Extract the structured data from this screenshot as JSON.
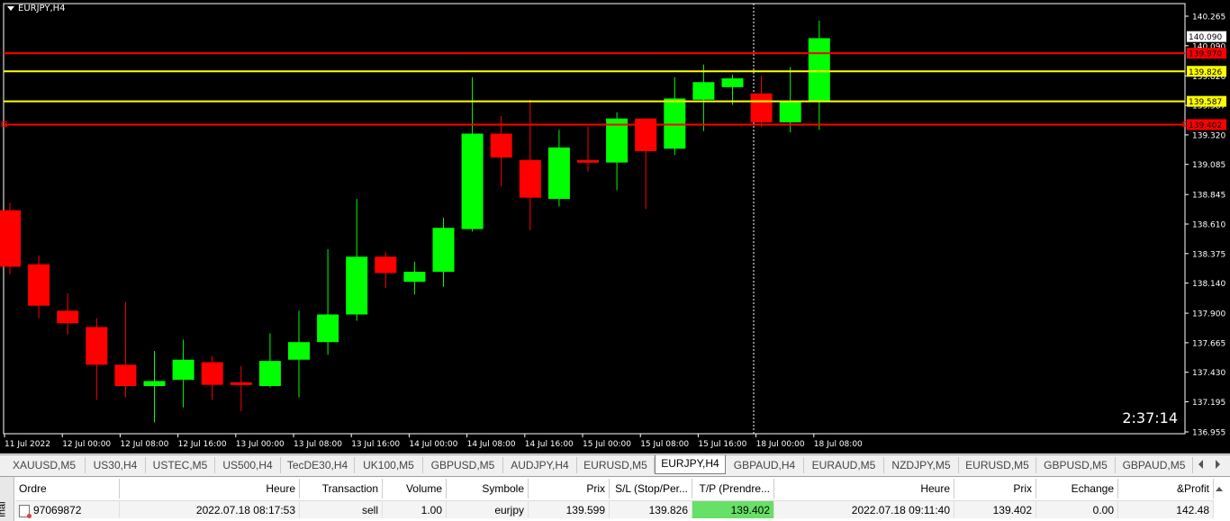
{
  "chart": {
    "symbol_title": "EURJPY,H4",
    "countdown": "2:37:14",
    "price_min": 136.955,
    "price_max": 140.265,
    "price_scale": [
      "140.265",
      "140.090",
      "139.826",
      "139.587",
      "139.320",
      "139.085",
      "138.845",
      "138.610",
      "138.375",
      "138.140",
      "137.900",
      "137.665",
      "137.430",
      "137.195",
      "136.955"
    ],
    "price_ticks": [
      140.265,
      140.03,
      139.79,
      139.555,
      139.32,
      139.085,
      138.845,
      138.61,
      138.375,
      138.14,
      137.9,
      137.665,
      137.43,
      137.195,
      136.955
    ],
    "time_labels": [
      "11 Jul 2022",
      "12 Jul 00:00",
      "12 Jul 08:00",
      "12 Jul 16:00",
      "13 Jul 00:00",
      "13 Jul 08:00",
      "13 Jul 16:00",
      "14 Jul 00:00",
      "14 Jul 08:00",
      "14 Jul 16:00",
      "15 Jul 00:00",
      "15 Jul 08:00",
      "15 Jul 16:00",
      "18 Jul 00:00",
      "18 Jul 08:00"
    ],
    "levels": [
      {
        "price": 139.97,
        "label": "139.970",
        "color": "#ff0000"
      },
      {
        "price": 139.826,
        "label": "139.826",
        "color": "#ffff00"
      },
      {
        "price": 139.587,
        "label": "139.587",
        "color": "#ffff00"
      },
      {
        "price": 139.402,
        "label": "139.402",
        "color": "#ff0000"
      }
    ],
    "bid_label": "140.090",
    "bull_color": "#00ff00",
    "bear_color": "#ff0000",
    "candles": [
      {
        "o": 138.72,
        "h": 138.78,
        "l": 138.21,
        "c": 138.27
      },
      {
        "o": 138.29,
        "h": 138.36,
        "l": 137.86,
        "c": 137.96
      },
      {
        "o": 137.92,
        "h": 138.06,
        "l": 137.73,
        "c": 137.82
      },
      {
        "o": 137.79,
        "h": 137.86,
        "l": 137.21,
        "c": 137.49
      },
      {
        "o": 137.49,
        "h": 137.99,
        "l": 137.23,
        "c": 137.32
      },
      {
        "o": 137.32,
        "h": 137.6,
        "l": 137.03,
        "c": 137.36
      },
      {
        "o": 137.37,
        "h": 137.69,
        "l": 137.15,
        "c": 137.53
      },
      {
        "o": 137.51,
        "h": 137.56,
        "l": 137.21,
        "c": 137.33
      },
      {
        "o": 137.35,
        "h": 137.48,
        "l": 137.12,
        "c": 137.33
      },
      {
        "o": 137.32,
        "h": 137.74,
        "l": 137.31,
        "c": 137.52
      },
      {
        "o": 137.53,
        "h": 137.92,
        "l": 137.23,
        "c": 137.67
      },
      {
        "o": 137.67,
        "h": 138.41,
        "l": 137.57,
        "c": 137.89
      },
      {
        "o": 137.89,
        "h": 138.81,
        "l": 137.84,
        "c": 138.35
      },
      {
        "o": 138.35,
        "h": 138.39,
        "l": 138.1,
        "c": 138.22
      },
      {
        "o": 138.15,
        "h": 138.31,
        "l": 138.05,
        "c": 138.23
      },
      {
        "o": 138.23,
        "h": 138.66,
        "l": 138.11,
        "c": 138.58
      },
      {
        "o": 138.57,
        "h": 139.78,
        "l": 138.55,
        "c": 139.33
      },
      {
        "o": 139.33,
        "h": 139.47,
        "l": 138.91,
        "c": 139.14
      },
      {
        "o": 139.12,
        "h": 139.6,
        "l": 138.56,
        "c": 138.82
      },
      {
        "o": 138.81,
        "h": 139.36,
        "l": 138.75,
        "c": 139.22
      },
      {
        "o": 139.12,
        "h": 139.39,
        "l": 139.03,
        "c": 139.1
      },
      {
        "o": 139.1,
        "h": 139.5,
        "l": 138.88,
        "c": 139.45
      },
      {
        "o": 139.45,
        "h": 139.45,
        "l": 138.73,
        "c": 139.19
      },
      {
        "o": 139.21,
        "h": 139.78,
        "l": 139.16,
        "c": 139.61
      },
      {
        "o": 139.6,
        "h": 139.88,
        "l": 139.35,
        "c": 139.74
      },
      {
        "o": 139.7,
        "h": 139.8,
        "l": 139.56,
        "c": 139.77
      },
      {
        "o": 139.65,
        "h": 139.79,
        "l": 139.38,
        "c": 139.42
      },
      {
        "o": 139.42,
        "h": 139.86,
        "l": 139.34,
        "c": 139.59
      },
      {
        "o": 139.59,
        "h": 140.23,
        "l": 139.36,
        "c": 140.09
      }
    ]
  },
  "tabs": [
    {
      "label": "XAUUSD,M5",
      "active": false
    },
    {
      "label": "US30,H4",
      "active": false
    },
    {
      "label": "USTEC,M5",
      "active": false
    },
    {
      "label": "US500,H4",
      "active": false
    },
    {
      "label": "TecDE30,H4",
      "active": false
    },
    {
      "label": "UK100,M5",
      "active": false
    },
    {
      "label": "GBPUSD,M5",
      "active": false
    },
    {
      "label": "AUDJPY,H4",
      "active": false
    },
    {
      "label": "EURUSD,M5",
      "active": false
    },
    {
      "label": "EURJPY,H4",
      "active": true
    },
    {
      "label": "GBPAUD,H4",
      "active": false
    },
    {
      "label": "EURAUD,M5",
      "active": false
    },
    {
      "label": "NZDJPY,M5",
      "active": false
    },
    {
      "label": "EURUSD,M5",
      "active": false
    },
    {
      "label": "GBPUSD,M5",
      "active": false
    },
    {
      "label": "GBPAUD,M5",
      "active": false
    }
  ],
  "terminal": {
    "side_label": "inal",
    "columns": [
      "Ordre",
      "Heure",
      "Transaction",
      "Volume",
      "Symbole",
      "Prix",
      "S/L (Stop/Per...",
      "T/P (Prendre...",
      "Heure",
      "Prix",
      "Echange",
      "&Profit"
    ],
    "row": [
      "97069872",
      "2022.07.18 08:17:53",
      "sell",
      "1.00",
      "eurjpy",
      "139.599",
      "139.826",
      "139.402",
      "2022.07.18 09:11:40",
      "139.402",
      "0.00",
      "142.48"
    ]
  }
}
